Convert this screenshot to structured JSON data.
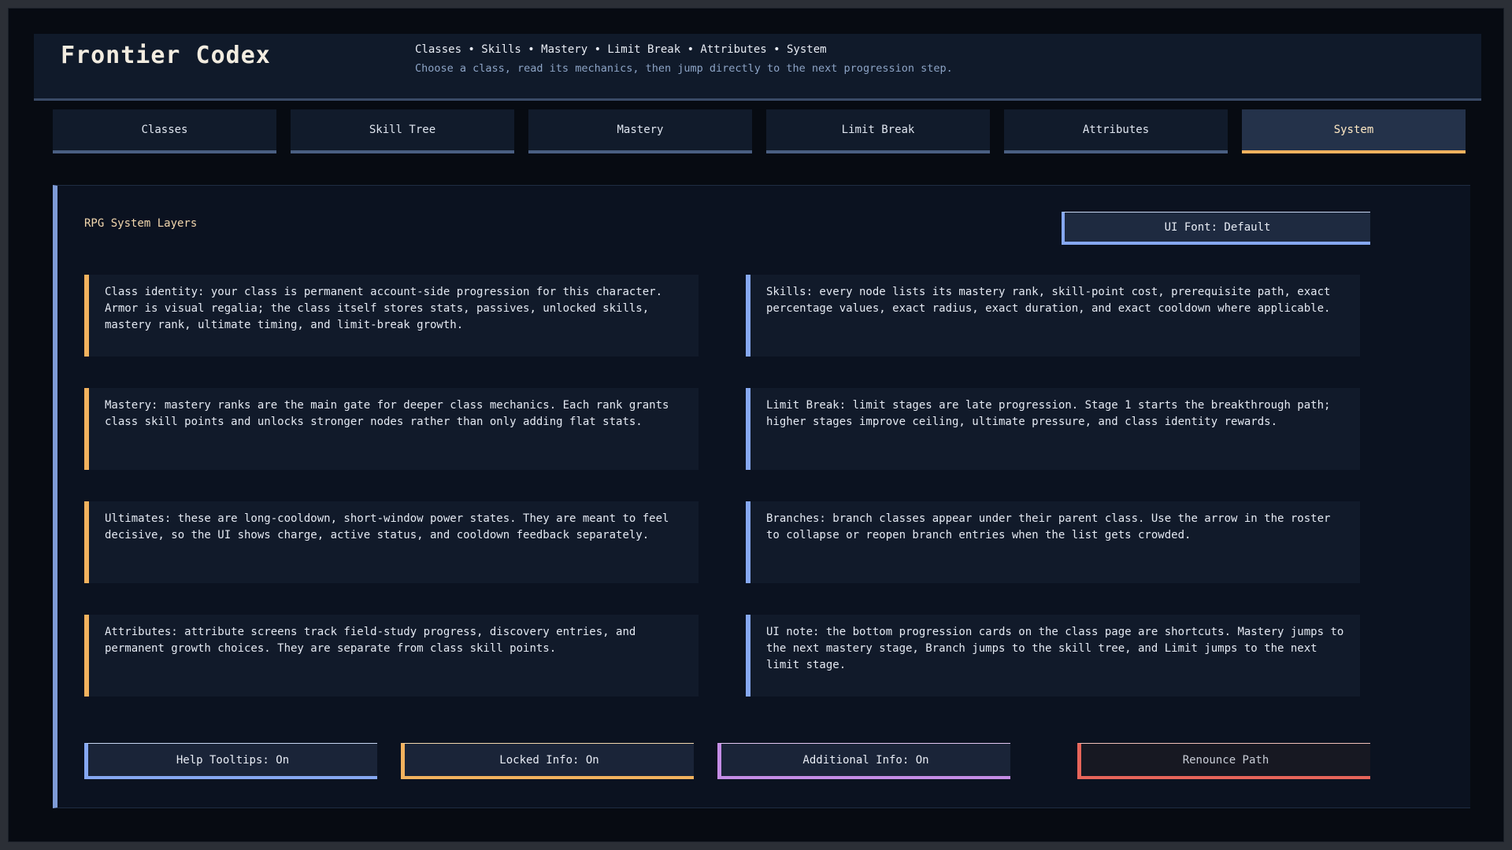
{
  "header": {
    "title": "Frontier Codex",
    "breadcrumb": "Classes • Skills • Mastery • Limit Break • Attributes • System",
    "subtitle": "Choose a class, read its mechanics, then jump directly to the next progression step."
  },
  "tabs": [
    {
      "label": "Classes",
      "active": false
    },
    {
      "label": "Skill Tree",
      "active": false
    },
    {
      "label": "Mastery",
      "active": false
    },
    {
      "label": "Limit Break",
      "active": false
    },
    {
      "label": "Attributes",
      "active": false
    },
    {
      "label": "System",
      "active": true
    }
  ],
  "panel": {
    "title": "RPG System Layers",
    "font_button": "UI Font: Default",
    "cards": [
      {
        "text": "Class identity: your class is permanent account-side progression for this character. Armor is visual regalia; the class itself stores stats, passives, unlocked skills, mastery rank, ultimate timing, and limit-break growth."
      },
      {
        "text": "Skills: every node lists its mastery rank, skill-point cost, prerequisite path, exact percentage values, exact radius, exact duration, and exact cooldown where applicable."
      },
      {
        "text": "Mastery: mastery ranks are the main gate for deeper class mechanics. Each rank grants class skill points and unlocks stronger nodes rather than only adding flat stats."
      },
      {
        "text": "Limit Break: limit stages are late progression. Stage 1 starts the breakthrough path; higher stages improve ceiling, ultimate pressure, and class identity rewards."
      },
      {
        "text": "Ultimates: these are long-cooldown, short-window power states. They are meant to feel decisive, so the UI shows charge, active status, and cooldown feedback separately."
      },
      {
        "text": "Branches: branch classes appear under their parent class. Use the arrow in the roster to collapse or reopen branch entries when the list gets crowded."
      },
      {
        "text": "Attributes: attribute screens track field-study progress, discovery entries, and permanent growth choices. They are separate from class skill points."
      },
      {
        "text": "UI note: the bottom progression cards on the class page are shortcuts. Mastery jumps to the next mastery stage, Branch jumps to the skill tree, and Limit jumps to the next limit stage."
      }
    ],
    "buttons": {
      "help_tooltips": "Help Tooltips: On",
      "locked_info": "Locked Info: On",
      "additional_info": "Additional Info: On",
      "renounce_path": "Renounce Path"
    }
  },
  "colors": {
    "accent_orange": "#f2b25e",
    "accent_blue": "#86a8f2",
    "accent_purple": "#c58de6",
    "accent_red": "#e8655a"
  }
}
